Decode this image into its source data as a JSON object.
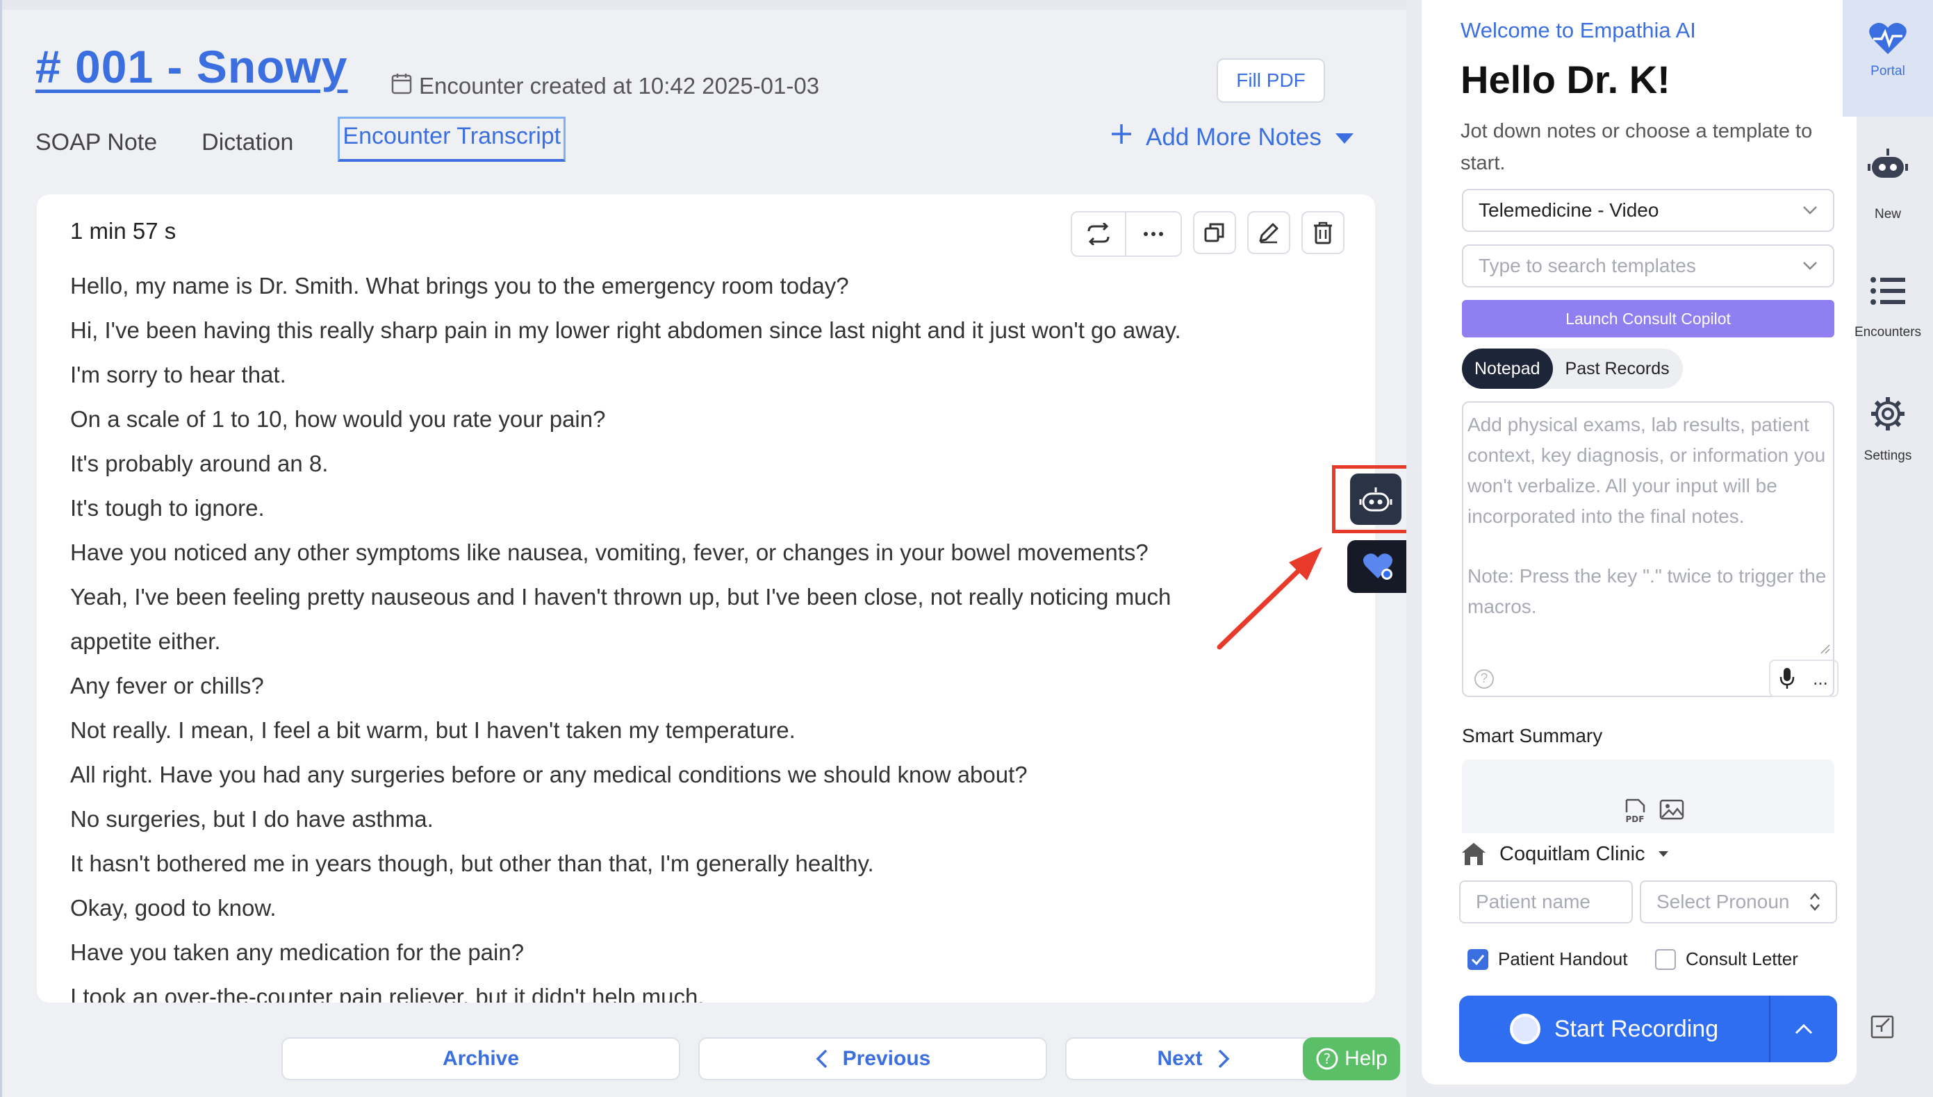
{
  "encounter": {
    "title": "# 001 - Snowy",
    "created": "Encounter created at 10:42 2025-01-03",
    "fill_pdf": "Fill PDF"
  },
  "tabs": [
    {
      "label": "SOAP Note"
    },
    {
      "label": "Dictation"
    },
    {
      "label": "Encounter Transcript",
      "active": true
    }
  ],
  "add_more_notes": "Add More Notes",
  "transcript": {
    "duration": "1 min 57 s",
    "lines": [
      "Hello, my name is Dr. Smith. What brings you to the emergency room today?",
      "Hi, I've been having this really sharp pain in my lower right abdomen since last night and it just won't go away.",
      "I'm sorry to hear that.",
      "On a scale of 1 to 10, how would you rate your pain?",
      "It's probably around an 8.",
      "It's tough to ignore.",
      "Have you noticed any other symptoms like nausea, vomiting, fever, or changes in your bowel movements?",
      "Yeah, I've been feeling pretty nauseous and I haven't thrown up, but I've been close, not really noticing much",
      "appetite either.",
      "Any fever or chills?",
      "Not really. I mean, I feel a bit warm, but I haven't taken my temperature.",
      "All right. Have you had any surgeries before or any medical conditions we should know about?",
      "No surgeries, but I do have asthma.",
      "It hasn't bothered me in years though, but other than that, I'm generally healthy.",
      "Okay, good to know.",
      "Have you taken any medication for the pain?",
      "I took an over-the-counter pain reliever, but it didn't help much."
    ]
  },
  "bottom_nav": {
    "archive": "Archive",
    "previous": "Previous",
    "next": "Next",
    "help": "Help"
  },
  "panel": {
    "welcome": "Welcome to Empathia AI",
    "hello": "Hello Dr. K!",
    "jot": "Jot down notes or choose a template to start.",
    "template_selected": "Telemedicine - Video",
    "template_search_placeholder": "Type to search templates",
    "launch": "Launch Consult Copilot",
    "pills": [
      "Notepad",
      "Past Records"
    ],
    "notepad_placeholder": "Add physical exams, lab results, patient context, key diagnosis, or information you won't verbalize. All your input will be incorporated into the final notes.",
    "notepad_note": "Note: Press the key \".\" twice to trigger the macros.",
    "notepad_help": "?",
    "notepad_more": "...",
    "smart_summary": "Smart Summary",
    "clinic": "Coquitlam Clinic",
    "patient_placeholder": "Patient name",
    "pronoun_placeholder": "Select Pronoun",
    "patient_handout": "Patient Handout",
    "patient_handout_checked": true,
    "consult_letter": "Consult Letter",
    "consult_letter_checked": false,
    "start_recording": "Start Recording"
  },
  "sidenav": [
    {
      "label": "Portal",
      "icon": "heart-pulse-icon"
    },
    {
      "label": "New",
      "icon": "robot-icon"
    },
    {
      "label": "Encounters",
      "icon": "list-icon"
    },
    {
      "label": "Settings",
      "icon": "gear-icon"
    }
  ],
  "colors": {
    "accent": "#3b6fe0",
    "launch": "#8f7ff0",
    "record": "#2f6ef0",
    "highlight_frame": "#e83a2a",
    "help": "#5bbf68"
  }
}
